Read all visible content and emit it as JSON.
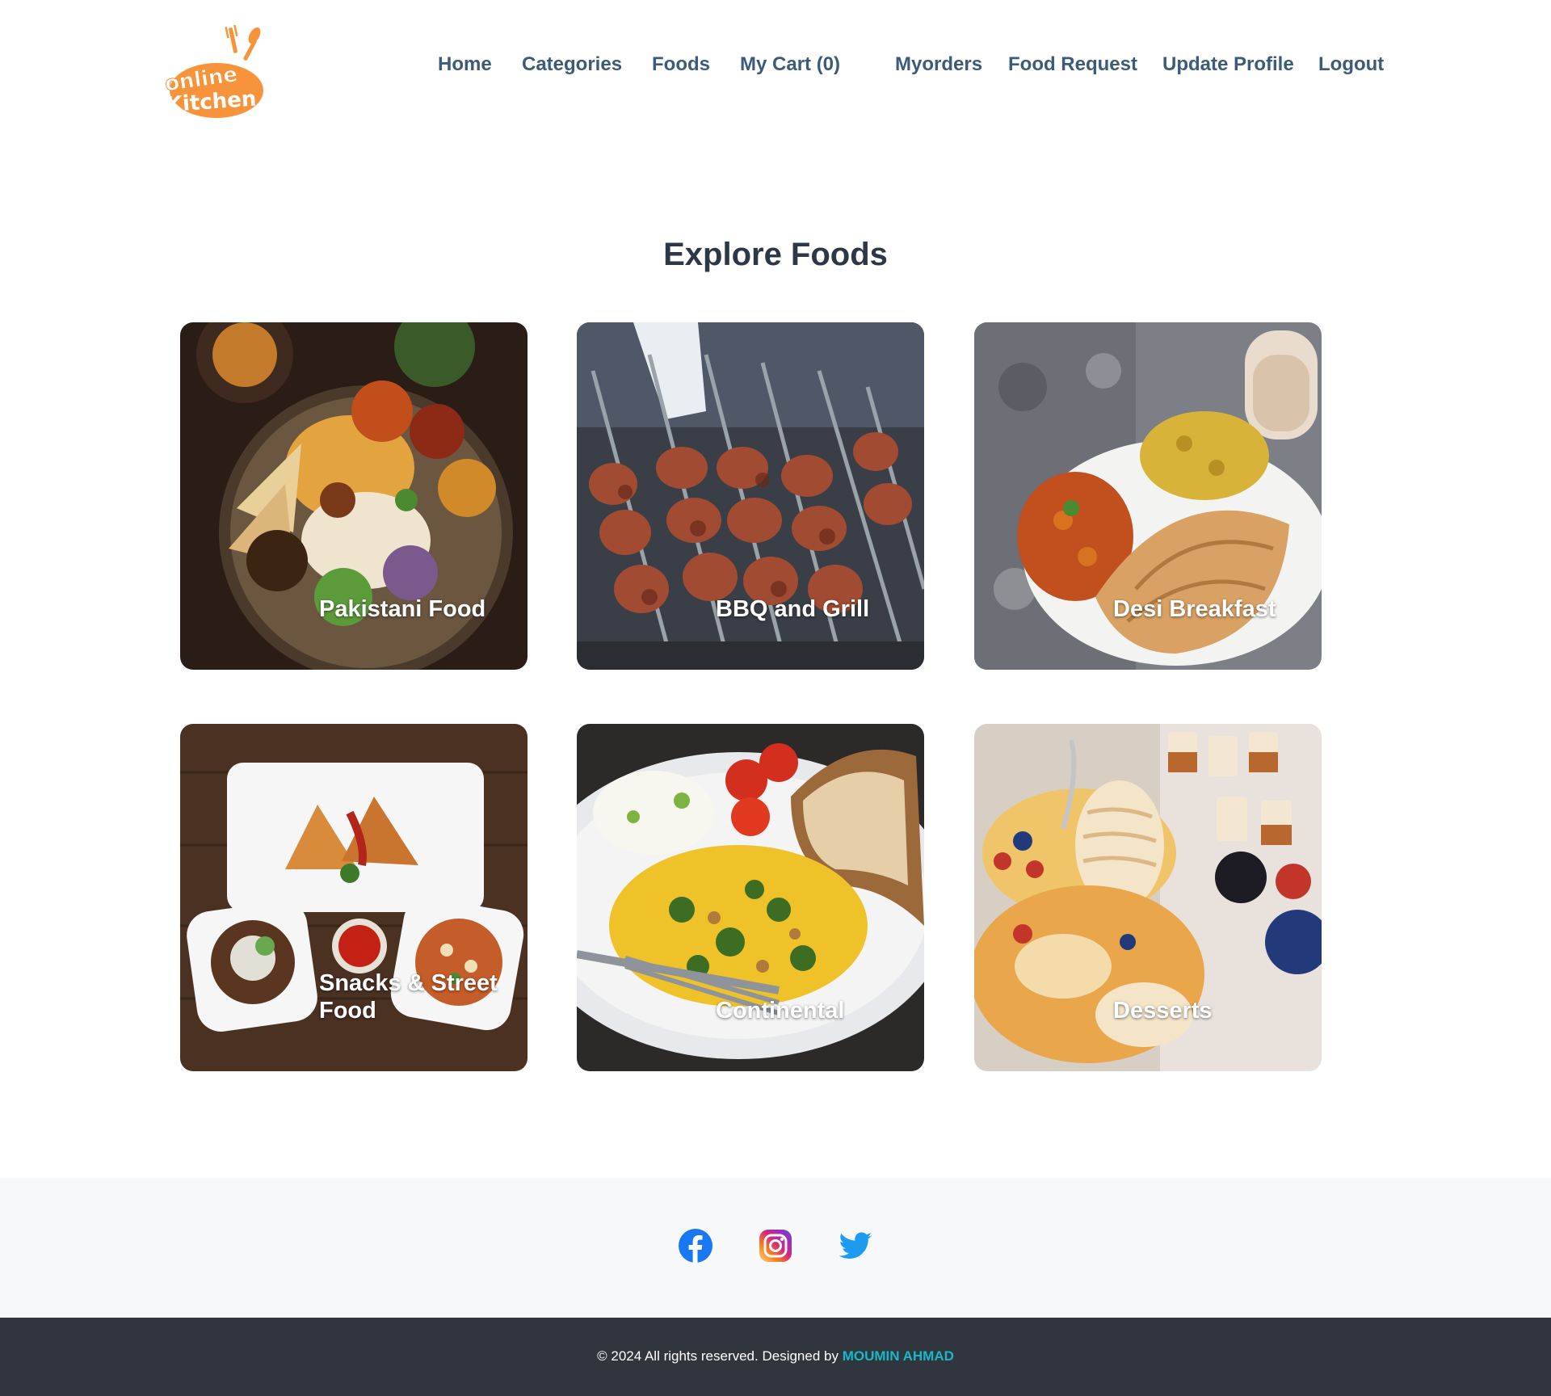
{
  "brand": {
    "logo_text_line1": "online",
    "logo_text_line2": "Kitchen",
    "logo_color": "#f7943b"
  },
  "nav": {
    "home": "Home",
    "categories": "Categories",
    "foods": "Foods",
    "cart": "My Cart (0)",
    "myorders": "Myorders",
    "food_request": "Food Request",
    "update_profile": "Update Profile",
    "logout": "Logout",
    "link_color": "#3c5a7a"
  },
  "main": {
    "title": "Explore Foods",
    "categories": [
      {
        "label": "Pakistani Food"
      },
      {
        "label": "BBQ and Grill"
      },
      {
        "label": "Desi Breakfast"
      },
      {
        "label": "Snacks & Street Food"
      },
      {
        "label": "Continental"
      },
      {
        "label": "Desserts"
      }
    ]
  },
  "social": {
    "icons": [
      "facebook-icon",
      "instagram-icon",
      "twitter-icon"
    ],
    "facebook_color": "#1877f2",
    "twitter_color": "#1d9bf0"
  },
  "footer": {
    "copyright": "© 2024 All rights reserved. Designed by ",
    "designer": "MOUMIN AHMAD",
    "designer_color": "#17b8c8"
  }
}
